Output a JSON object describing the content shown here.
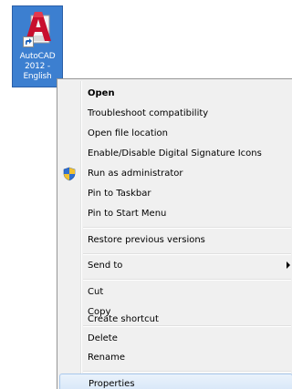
{
  "desktop_icon": {
    "label_lines": [
      "AutoCAD",
      "2012 -",
      "English"
    ],
    "icon_name": "autocad-app-icon",
    "accent_color": "#c8102e",
    "selection_color": "#3c7fd0"
  },
  "context_menu": {
    "items": [
      {
        "label": "Open",
        "bold": true
      },
      {
        "label": "Troubleshoot compatibility"
      },
      {
        "label": "Open file location"
      },
      {
        "label": "Enable/Disable Digital Signature Icons"
      },
      {
        "label": "Run as administrator",
        "icon": "uac-shield-icon"
      },
      {
        "label": "Pin to Taskbar"
      },
      {
        "label": "Pin to Start Menu"
      },
      {
        "label": "Restore previous versions"
      },
      {
        "label": "Send to",
        "submenu": true
      },
      {
        "label": "Cut"
      },
      {
        "label": "Copy"
      },
      {
        "label": "Create shortcut"
      },
      {
        "label": "Delete"
      },
      {
        "label": "Rename"
      },
      {
        "label": "Properties",
        "hovered": true
      }
    ]
  }
}
